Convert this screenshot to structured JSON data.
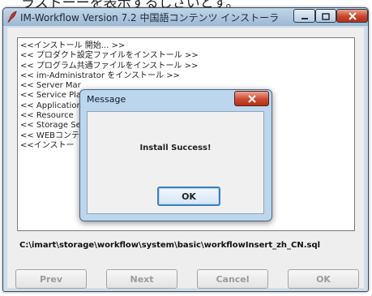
{
  "background_caption": "ラストーーを表示するしさいとす。",
  "window": {
    "title": "IM-Workflow Version 7.2  中国語コンテンツ インストーラ",
    "minimize_icon": "minimize-icon",
    "maximize_icon": "maximize-icon",
    "close_icon": "close-icon"
  },
  "log_lines": [
    "<<インストール 開始... >>",
    "<< プロダクト設定ファイルをインストール >>",
    "<< プログラム共通ファイルをインストール >>",
    "<< im-Administrator をインストール >>",
    "<< Server Mar",
    "<< Service Pla",
    "<< Application",
    "<< Resource",
    "<< Storage Se",
    "<< WEBコンテ",
    "<<インストー"
  ],
  "status_path": "C:\\imart\\storage\\workflow\\system\\basic\\workflowInsert_zh_CN.sql",
  "buttons": {
    "prev": "Prev",
    "next": "Next",
    "cancel": "Cancel",
    "ok": "OK"
  },
  "dialog": {
    "title": "Message",
    "message": "Install Success!",
    "ok_label": "OK"
  },
  "colors": {
    "close_red": "#c8442c",
    "dialog_frame": "#b7d4ec",
    "disabled_text": "#9b9b9b"
  }
}
